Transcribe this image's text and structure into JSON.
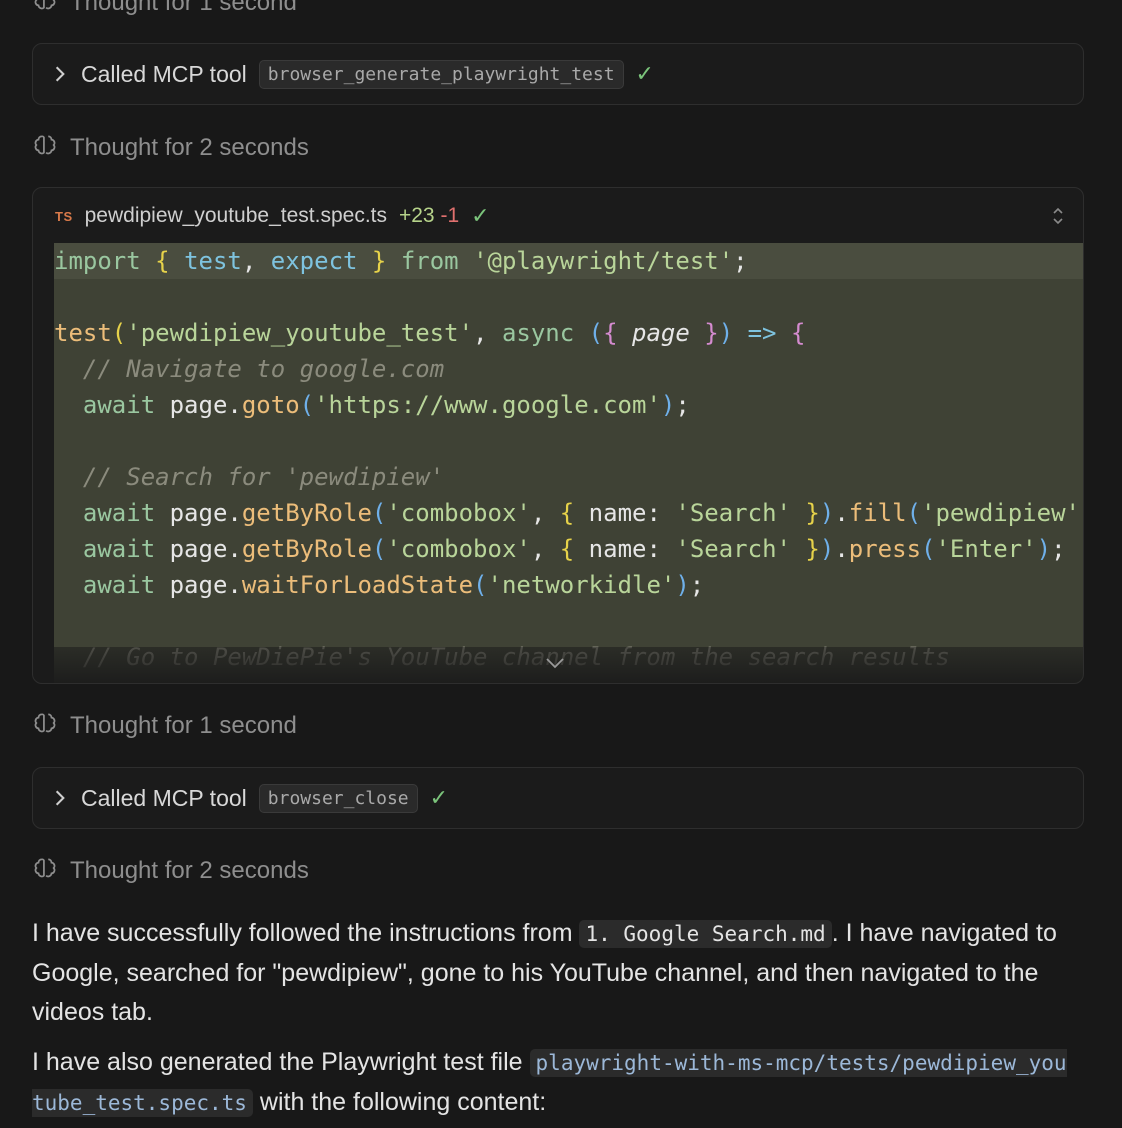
{
  "thoughts": [
    {
      "label": "Thought for 1 second"
    },
    {
      "label": "Thought for 2 seconds"
    },
    {
      "label": "Thought for 1 second"
    },
    {
      "label": "Thought for 2 seconds"
    }
  ],
  "tool_calls": [
    {
      "label": "Called MCP tool",
      "tool": "browser_generate_playwright_test"
    },
    {
      "label": "Called MCP tool",
      "tool": "browser_close"
    }
  ],
  "code_card": {
    "lang_badge": "TS",
    "filename": "pewdipiew_youtube_test.spec.ts",
    "additions": "+23",
    "deletions": "-1",
    "status_check": "✓"
  },
  "message": {
    "p1_before": "I have successfully followed the instructions from",
    "p1_code": "1. Google Search.md",
    "p1_after": ". I have navigated to Google, searched for \"pewdipiew\", gone to his YouTube channel, and then navigated to the videos tab.",
    "p2_before": "I have also generated the Playwright test file",
    "p2_code": "playwright-with-ms-mcp/tests/pewdipiew_youtube_test.spec.ts",
    "p2_after": "with the following content:"
  },
  "icons": {
    "thought": "brain-icon",
    "tool_chevron": "chevron-right-icon",
    "check": "check-icon",
    "expand": "chevrons-up-down-icon",
    "scroll_more": "chevron-down-icon"
  },
  "colors": {
    "background": "#181818",
    "code_highlight": "#3f4235",
    "check_green": "#7bc47b",
    "additions": "#b6d38a",
    "deletions": "#e0706e"
  }
}
